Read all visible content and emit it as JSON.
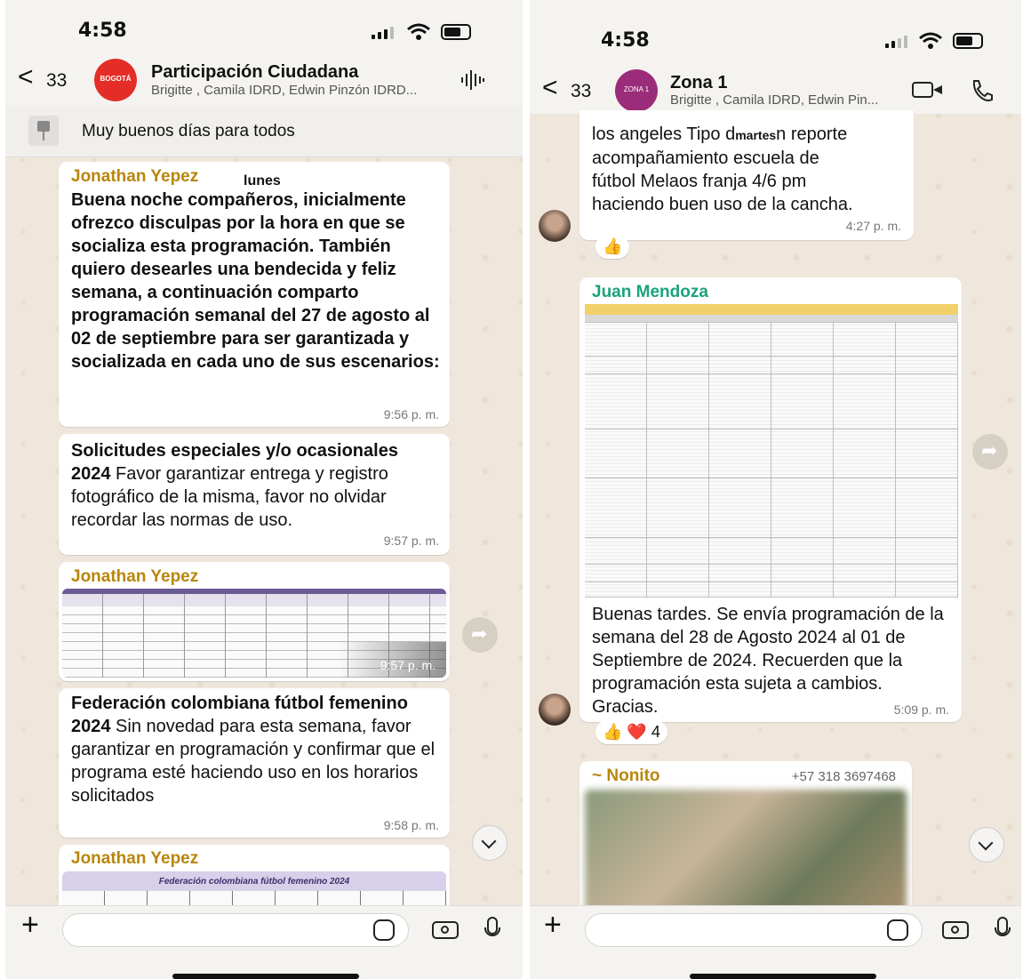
{
  "left": {
    "status_time": "4:58",
    "back_count": "33",
    "avatar_text": "BOGOTÁ",
    "chat_title": "Participación Ciudadana",
    "chat_members": "Brigitte , Camila IDRD, Edwin Pinzón IDRD...",
    "pinned_text": "Muy buenos días para todos",
    "day_label": "lunes",
    "messages": [
      {
        "sender": "Jonathan Yepez",
        "text": "Buena noche compañeros, inicialmente ofrezco disculpas por la hora en que se socializa esta programación. También quiero desearles una bendecida y feliz semana, a continuación comparto programación semanal del 27 de agosto al 02 de septiembre para ser garantizada y socializada en cada uno de sus escenarios:",
        "time": "9:56 p. m."
      },
      {
        "bold": "Solicitudes especiales y/o ocasionales 2024",
        "text": " Favor garantizar entrega y registro fotográfico de la misma, favor no olvidar recordar las normas de uso.",
        "time": "9:57 p. m."
      },
      {
        "sender": "Jonathan Yepez",
        "time": "9:57 p. m."
      },
      {
        "bold": "Federación colombiana fútbol femenino 2024",
        "text": " Sin novedad para esta semana, favor garantizar en programación y confirmar que el programa esté haciendo uso en los horarios solicitados",
        "time": "9:58 p. m."
      },
      {
        "sender": "Jonathan Yepez",
        "image_title": "Federación colombiana fútbol femenino 2024"
      }
    ]
  },
  "right": {
    "status_time": "4:58",
    "back_count": "33",
    "avatar_text": "ZONA 1",
    "chat_title": "Zona 1",
    "chat_members": "Brigitte , Camila IDRD, Edwin Pin...",
    "msg1_lines": [
      "los angeles Tipo d",
      "n reporte",
      "acompañamiento escuela de",
      "fútbol Melaos franja 4/6 pm",
      "haciendo buen uso de la cancha."
    ],
    "msg1_day": "martes",
    "msg1_time": "4:27 p. m.",
    "msg1_reaction": "👍",
    "msg2_sender": "Juan Mendoza",
    "msg2_text": "Buenas tardes. Se envía programación de la semana del 28 de Agosto 2024 al 01 de Septiembre de 2024. Recuerden que la programación esta sujeta a cambios. Gracias.",
    "msg2_time": "5:09 p. m.",
    "msg2_reactions": "👍 ❤️ 4",
    "msg3_sender": "~ Nonito",
    "msg3_phone": "+57 318 3697468"
  },
  "colors": {
    "sender_left": "#b8860b",
    "sender_right": "#1aa37a",
    "table_header_left": "#6b5b95",
    "table_header_right": "#f2d16b"
  }
}
